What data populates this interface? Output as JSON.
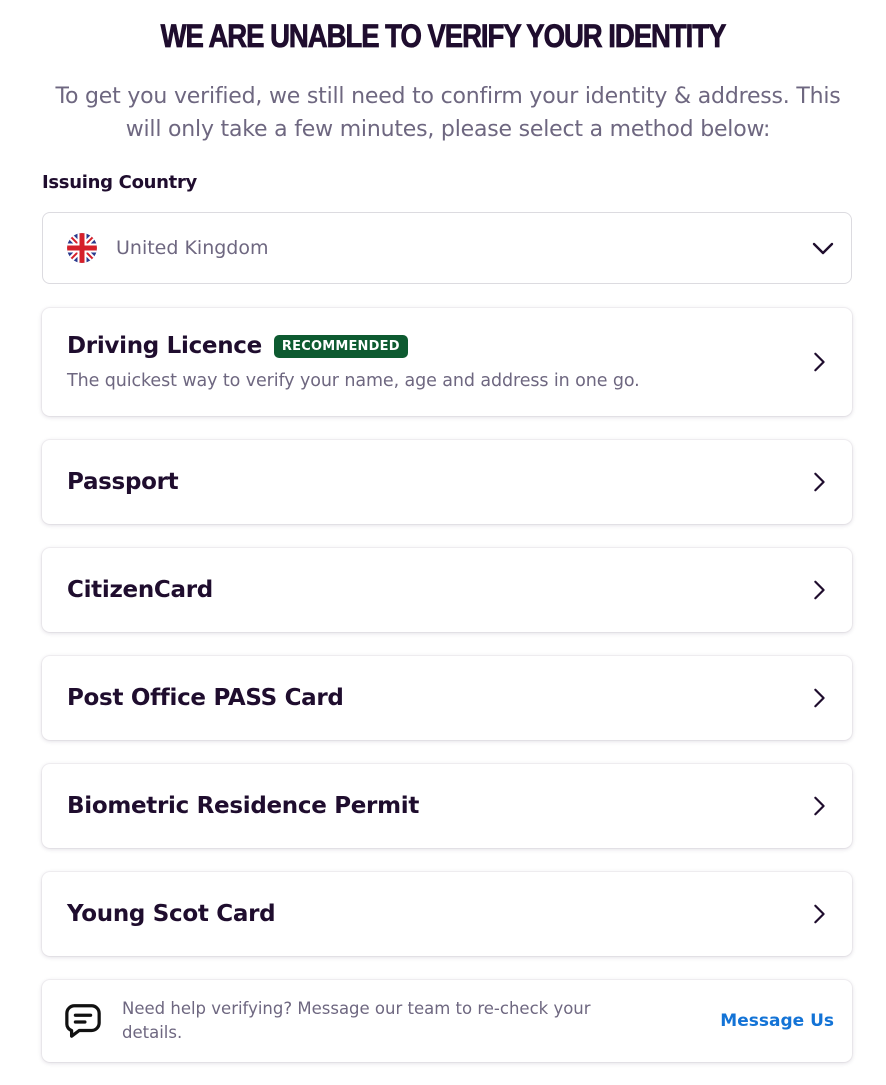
{
  "header": {
    "title": "WE ARE UNABLE TO VERIFY YOUR IDENTITY",
    "subtitle": "To get you verified, we still need to confirm your identity & address. This will only take a few minutes, please select a method below:"
  },
  "country": {
    "label": "Issuing Country",
    "value": "United Kingdom",
    "flag_icon": "uk-flag-icon"
  },
  "methods": [
    {
      "title": "Driving Licence",
      "badge": "RECOMMENDED",
      "description": "The quickest way to verify your name, age and address in one go."
    },
    {
      "title": "Passport"
    },
    {
      "title": "CitizenCard"
    },
    {
      "title": "Post Office PASS Card"
    },
    {
      "title": "Biometric Residence Permit"
    },
    {
      "title": "Young Scot Card"
    }
  ],
  "help": {
    "text": "Need help verifying? Message our team to re-check your details.",
    "link": "Message Us",
    "icon": "chat-bubble-icon"
  },
  "colors": {
    "text_dark": "#1f0d2e",
    "text_muted": "#6e6780",
    "badge_green": "#0d5a30",
    "link_blue": "#1373d6"
  }
}
